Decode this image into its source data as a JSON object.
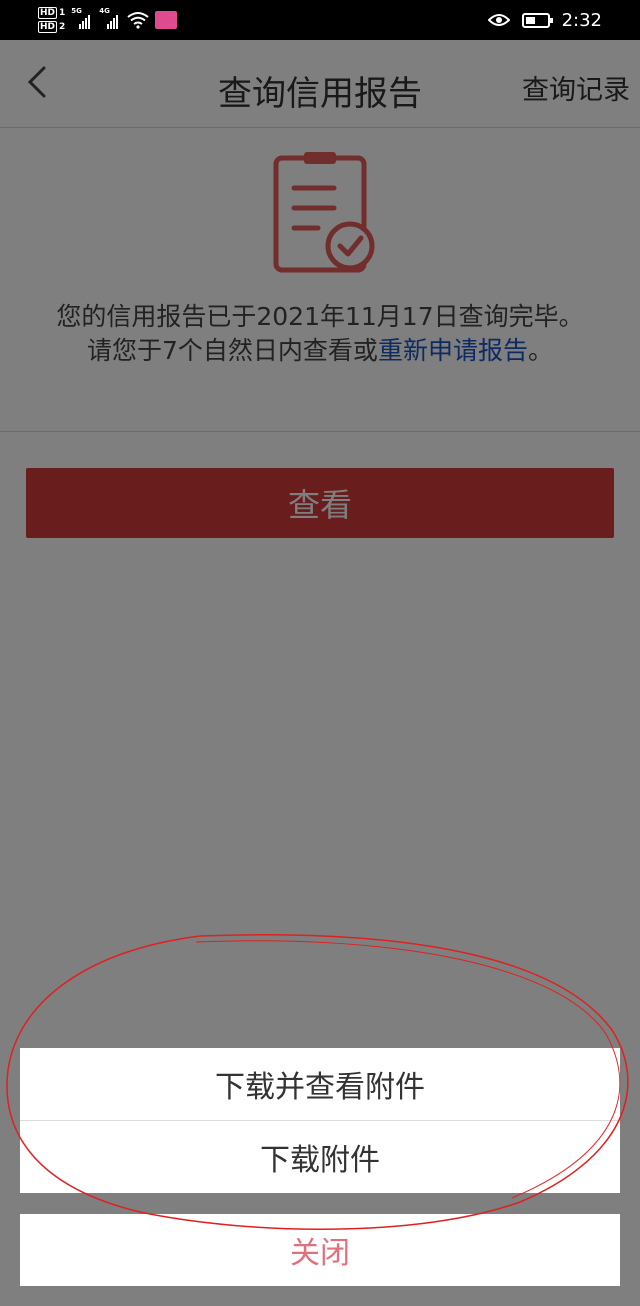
{
  "status_bar": {
    "hd1": "HD",
    "hd1_num": "1",
    "hd2": "HD",
    "hd2_num": "2",
    "signal1_gen": "5G",
    "signal2_gen": "4G",
    "time": "2:32",
    "battery_level": 0.4,
    "icons": [
      "signal-icon",
      "wifi-icon",
      "app-badge-icon",
      "eye-icon",
      "battery-icon"
    ]
  },
  "header": {
    "title": "查询信用报告",
    "right_link": "查询记录",
    "back_icon": "chevron-left-icon"
  },
  "notice": {
    "icon": "report-checked-icon",
    "line1": "您的信用报告已于2021年11月17日查询完毕。",
    "line2_prefix": "请您于7个自然日内查看或",
    "line2_link": "重新申请报告",
    "line2_suffix": "。"
  },
  "actions": {
    "view_label": "查看"
  },
  "action_sheet": {
    "options": [
      "下载并查看附件",
      "下载附件"
    ],
    "close_label": "关闭"
  },
  "colors": {
    "primary_red": "#d33b3b",
    "link_blue": "#1a56c4",
    "close_pink": "#e0707e",
    "annotation_red": "#e02020"
  }
}
